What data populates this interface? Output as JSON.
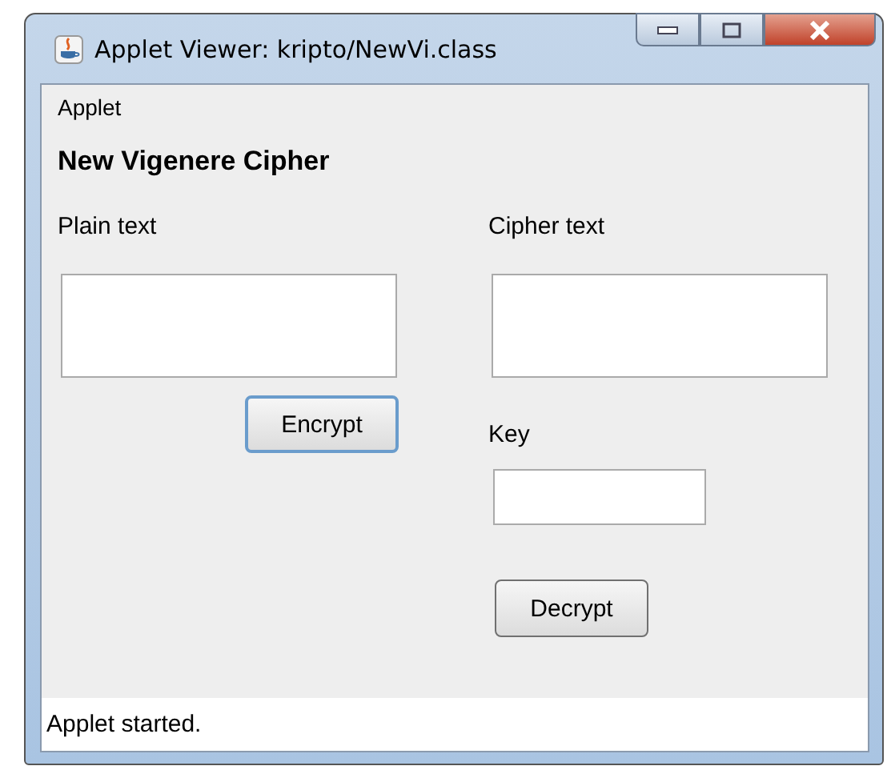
{
  "window": {
    "title": "Applet Viewer: kripto/NewVi.class"
  },
  "menu": [
    "Applet"
  ],
  "heading": "New Vigenere Cipher",
  "left": {
    "label": "Plain text",
    "button": {
      "label": "Encrypt",
      "focused": true
    }
  },
  "right": {
    "label": "Cipher text",
    "key_label": "Key",
    "button": {
      "label": "Decrypt",
      "focused": false
    }
  },
  "status_bar": "Applet started."
}
